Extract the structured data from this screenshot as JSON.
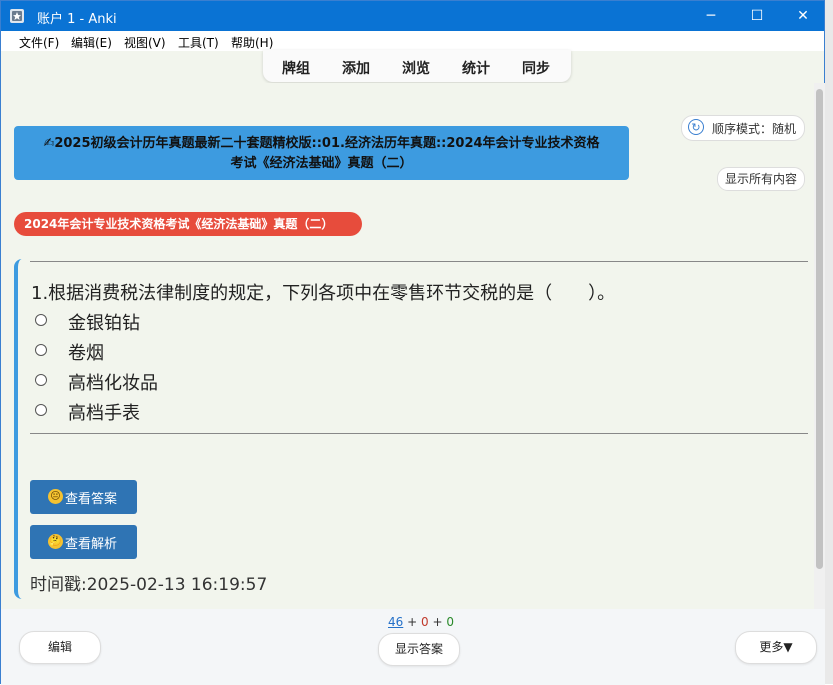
{
  "window": {
    "title": "账户 1 - Anki",
    "minimize_glyph": "─",
    "maximize_glyph": "☐",
    "close_glyph": "✕"
  },
  "menu": [
    "文件(F)",
    "编辑(E)",
    "视图(V)",
    "工具(T)",
    "帮助(H)"
  ],
  "toolbar": [
    "牌组",
    "添加",
    "浏览",
    "统计",
    "同步"
  ],
  "reviewer": {
    "deck_line1": "✍2025初级会计历年真题最新二十套题精校版::01.经济法历年真题::2024年会计专业技术资格",
    "deck_line2": "考试《经济法基础》真题（二）",
    "order_mode_icon": "↻",
    "order_mode_label": "顺序模式：随机",
    "show_all_label": "显示所有内容",
    "subdeck_badge": "2024年会计专业技术资格考试《经济法基础》真题（二）",
    "question": "1.根据消费税法律制度的规定，下列各项中在零售环节交税的是（　　）。",
    "options": [
      "金银铂钻",
      "卷烟",
      "高档化妆品",
      "高档手表"
    ],
    "view_answer_label": "查看答案",
    "view_answer_emoji": "😐",
    "view_analysis_label": "查看解析",
    "view_analysis_emoji": "🤔",
    "timestamp": "时间戳:2025-02-13 16:19:57"
  },
  "bottom": {
    "count_new": "46",
    "count_learn": "0",
    "count_review": "0",
    "plus": "+",
    "edit_label": "编辑",
    "show_answer_label": "显示答案",
    "more_label": "更多▼"
  },
  "colors": {
    "titlebar": "#0a73d4",
    "deck_banner": "#3d9be0",
    "subdeck_badge": "#e74c3c",
    "action_button": "#2f74b4"
  }
}
